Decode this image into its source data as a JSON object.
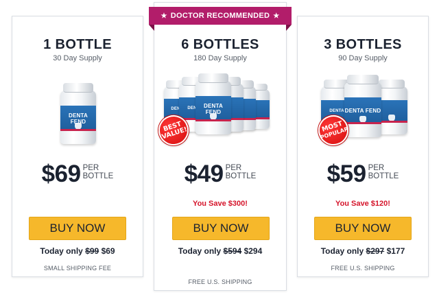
{
  "badge": {
    "text": "DOCTOR RECOMMENDED",
    "star_icon": "★",
    "color": "#b21d6a"
  },
  "product_brand": "DENTA FEND",
  "colors": {
    "button": "#f6b82b",
    "savings": "#d5142a",
    "sticker": "#e01515"
  },
  "packages": [
    {
      "title": "1 BOTTLE",
      "supply": "30 Day Supply",
      "bottle_count": 1,
      "price": "$69",
      "per_line1": "PER",
      "per_line2": "BOTTLE",
      "savings": "",
      "button": "BUY NOW",
      "today_prefix": "Today only",
      "old_price": "$99",
      "new_price": "$69",
      "shipping": "SMALL SHIPPING FEE"
    },
    {
      "title": "6 BOTTLES",
      "supply": "180 Day Supply",
      "bottle_count": 6,
      "sticker": {
        "line1": "BEST",
        "line2": "VALUE!"
      },
      "price": "$49",
      "per_line1": "PER",
      "per_line2": "BOTTLE",
      "savings": "You Save $300!",
      "button": "BUY NOW",
      "today_prefix": "Today only",
      "old_price": "$594",
      "new_price": "$294",
      "shipping": "FREE U.S. SHIPPING"
    },
    {
      "title": "3 BOTTLES",
      "supply": "90 Day Supply",
      "bottle_count": 3,
      "sticker": {
        "line1": "MOST",
        "line2": "POPULAR"
      },
      "price": "$59",
      "per_line1": "PER",
      "per_line2": "BOTTLE",
      "savings": "You Save $120!",
      "button": "BUY NOW",
      "today_prefix": "Today only",
      "old_price": "$297",
      "new_price": "$177",
      "shipping": "FREE U.S. SHIPPING"
    }
  ]
}
